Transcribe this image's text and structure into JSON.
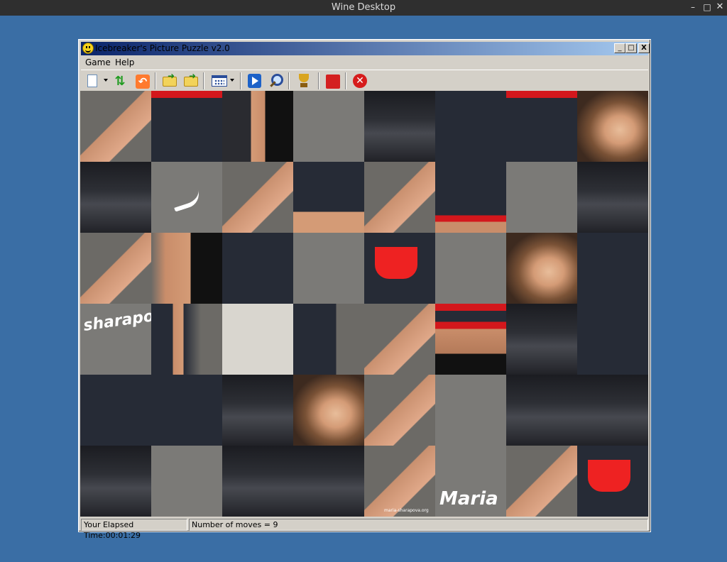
{
  "host": {
    "title": "Wine Desktop",
    "controls": {
      "minimize": "–",
      "maximize": "□",
      "close": "✕"
    }
  },
  "window": {
    "title": "Icebreaker's Picture Puzzle v2.0",
    "controls": {
      "minimize": "_",
      "maximize": "□",
      "close": "X"
    }
  },
  "menu": {
    "game": "Game",
    "help": "Help"
  },
  "toolbar": {
    "items": [
      "new-game-icon",
      "shuffle-icon",
      "undo-icon",
      "open-folder-icon",
      "open-folder-next-icon",
      "grid-size-icon",
      "play-icon",
      "zoom-icon",
      "trophy-icon",
      "settings-icon",
      "exit-icon"
    ]
  },
  "puzzle": {
    "columns": 8,
    "rows": 6,
    "empty_tile": {
      "row": 4,
      "col": 3
    },
    "watermark_text_1": "Maria",
    "watermark_text_2": "sharapova",
    "watermark_text_3": "maria-sharapova.org",
    "logo_text": "Sh"
  },
  "status": {
    "elapsed": "Your Elapsed Time:00:01:29",
    "moves": "Number of moves = 9"
  },
  "colors": {
    "desktop": "#3a6ea5",
    "title_gradient_start": "#0a246a",
    "title_gradient_end": "#a6caf0",
    "face": "#d4d0c8",
    "accent_red": "#d3171c"
  }
}
